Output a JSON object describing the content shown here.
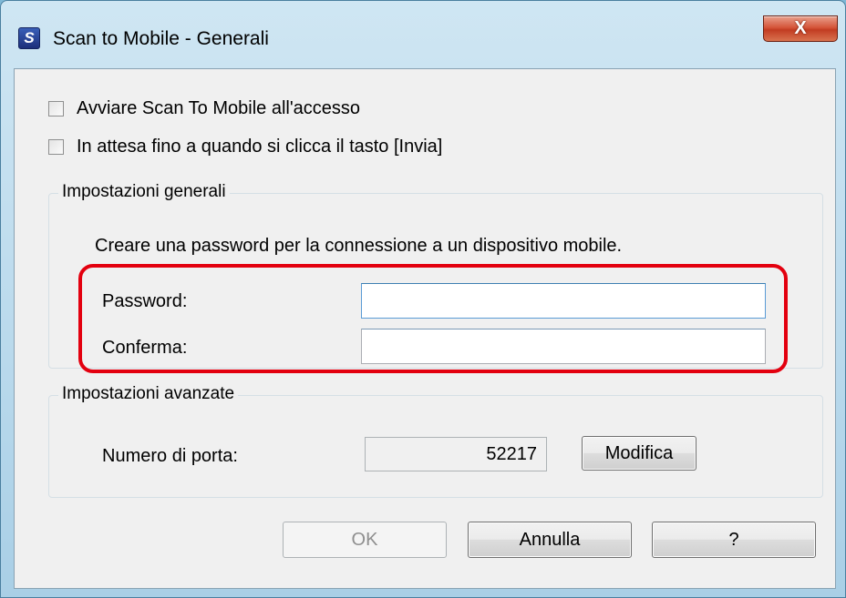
{
  "window": {
    "title": "Scan to Mobile - Generali",
    "icon_letter": "S",
    "close_glyph": "X"
  },
  "options": {
    "start_at_login": {
      "label": "Avviare Scan To Mobile all'accesso",
      "checked": false
    },
    "wait_for_send": {
      "label": "In attesa fino a quando si clicca il tasto [Invia]",
      "checked": false
    }
  },
  "general_settings": {
    "title": "Impostazioni generali",
    "description": "Creare una password per la connessione a un dispositivo mobile.",
    "password_label": "Password:",
    "password_value": "",
    "confirm_label": "Conferma:",
    "confirm_value": ""
  },
  "advanced_settings": {
    "title": "Impostazioni avanzate",
    "port_label": "Numero di porta:",
    "port_value": "52217",
    "modify_label": "Modifica"
  },
  "buttons": {
    "ok": "OK",
    "cancel": "Annulla",
    "help": "?"
  },
  "colors": {
    "highlight": "#e3000f",
    "desktop": "#7fb8d6"
  }
}
